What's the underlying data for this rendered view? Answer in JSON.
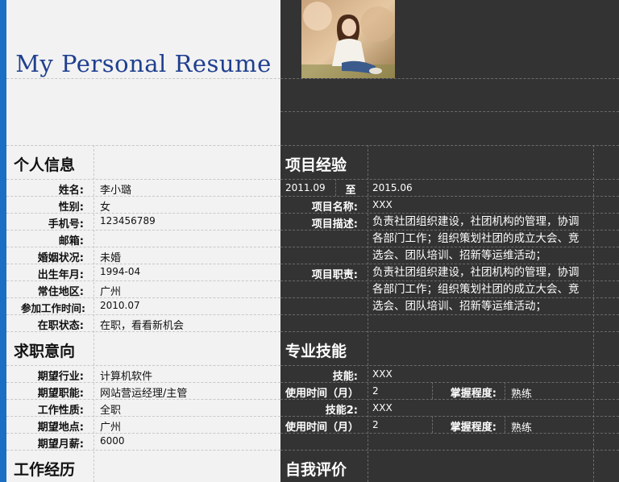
{
  "header": {
    "title": "My Personal Resume"
  },
  "personal": {
    "section": "个人信息",
    "rows": [
      {
        "label": "姓名:",
        "value": "李小璐"
      },
      {
        "label": "性别:",
        "value": "女"
      },
      {
        "label": "手机号:",
        "value": "123456789"
      },
      {
        "label": "邮箱:",
        "value": ""
      },
      {
        "label": "婚姻状况:",
        "value": "未婚"
      },
      {
        "label": "出生年月:",
        "value": "1994-04"
      },
      {
        "label": "常住地区:",
        "value": "广州"
      },
      {
        "label": "参加工作时间:",
        "value": "2010.07"
      },
      {
        "label": "在职状态:",
        "value": "在职，看看新机会"
      }
    ]
  },
  "intent": {
    "section": "求职意向",
    "rows": [
      {
        "label": "期望行业:",
        "value": "计算机软件"
      },
      {
        "label": "期望职能:",
        "value": "网站营运经理/主管"
      },
      {
        "label": "工作性质:",
        "value": "全职"
      },
      {
        "label": "期望地点:",
        "value": "广州"
      },
      {
        "label": "期望月薪:",
        "value": "6000"
      }
    ]
  },
  "work": {
    "section": "工作经历"
  },
  "project": {
    "section": "项目经验",
    "start": "2011.09",
    "to": "至",
    "end": "2015.06",
    "name_label": "项目名称:",
    "name_value": "XXX",
    "desc_label": "项目描述:",
    "desc_lines": [
      "负责社团组织建设，社团机构的管理，协调",
      "各部门工作；组织策划社团的成立大会、竞",
      "选会、团队培训、招新等运维活动；"
    ],
    "duty_label": "项目职责:",
    "duty_lines": [
      "负责社团组织建设，社团机构的管理，协调",
      "各部门工作；组织策划社团的成立大会、竞",
      "选会、团队培训、招新等运维活动；"
    ]
  },
  "skills": {
    "section": "专业技能",
    "skill1_label": "技能:",
    "skill1_value": "XXX",
    "time1_label": "使用时间（月）",
    "time1_value": "2",
    "level1_label": "掌握程度:",
    "level1_value": "熟练",
    "skill2_label": "技能2:",
    "skill2_value": "XXX",
    "time2_label": "使用时间（月）",
    "time2_value": "2",
    "level2_label": "掌握程度:",
    "level2_value": "熟练"
  },
  "self_eval": {
    "section": "自我评价"
  }
}
